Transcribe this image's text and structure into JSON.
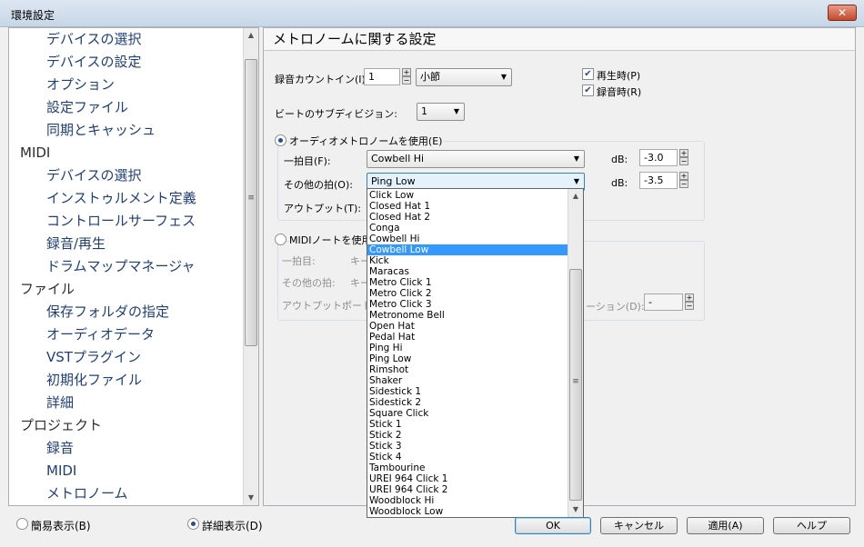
{
  "window": {
    "title": "環境設定",
    "close_glyph": "✕"
  },
  "tree": {
    "items": [
      {
        "label": "デバイスの選択",
        "level": 1
      },
      {
        "label": "デバイスの設定",
        "level": 1
      },
      {
        "label": "オプション",
        "level": 1
      },
      {
        "label": "設定ファイル",
        "level": 1
      },
      {
        "label": "同期とキャッシュ",
        "level": 1
      },
      {
        "label": "MIDI",
        "level": 0
      },
      {
        "label": "デバイスの選択",
        "level": 1
      },
      {
        "label": "インストゥルメント定義",
        "level": 1
      },
      {
        "label": "コントロールサーフェス",
        "level": 1
      },
      {
        "label": "録音/再生",
        "level": 1
      },
      {
        "label": "ドラムマップマネージャ",
        "level": 1
      },
      {
        "label": "ファイル",
        "level": 0
      },
      {
        "label": "保存フォルダの指定",
        "level": 1
      },
      {
        "label": "オーディオデータ",
        "level": 1
      },
      {
        "label": "VSTプラグイン",
        "level": 1
      },
      {
        "label": "初期化ファイル",
        "level": 1
      },
      {
        "label": "詳細",
        "level": 1
      },
      {
        "label": "プロジェクト",
        "level": 0
      },
      {
        "label": "録音",
        "level": 1
      },
      {
        "label": "MIDI",
        "level": 1
      },
      {
        "label": "メトロノーム",
        "level": 1
      }
    ]
  },
  "panel": {
    "header": "メトロノームに関する設定",
    "count_in_label": "録音カウントイン(I):",
    "count_in_value": "1",
    "count_in_unit": "小節",
    "play_label": "再生時(P)",
    "rec_label": "録音時(R)",
    "subdiv_label": "ビートのサブディビジョン:",
    "subdiv_value": "1",
    "audio_radio_label": "オーディオメトロノームを使用(E)",
    "first_beat_label": "一拍目(F):",
    "first_beat_value": "Cowbell Hi",
    "other_beat_label": "その他の拍(O):",
    "other_beat_value": "Ping Low",
    "db_label": "dB:",
    "first_db": "-3.0",
    "other_db": "-3.5",
    "output_label": "アウトプット(T):",
    "midi_radio_label": "MIDIノートを使用(",
    "midi_first_label": "一拍目:",
    "midi_first_key": "キー",
    "midi_other_label": "その他の拍:",
    "midi_other_key": "キー",
    "midi_output_label": "アウトプット:",
    "midi_output_value": "ポート",
    "midi_velocity_label": "ーション(D):",
    "midi_velocity_value": "-"
  },
  "dropdown": {
    "selected": "Cowbell Low",
    "options": [
      "Click Low",
      "Closed Hat 1",
      "Closed Hat 2",
      "Conga",
      "Cowbell Hi",
      "Cowbell Low",
      "Kick",
      "Maracas",
      "Metro Click 1",
      "Metro Click 2",
      "Metro Click 3",
      "Metronome Bell",
      "Open Hat",
      "Pedal Hat",
      "Ping Hi",
      "Ping Low",
      "Rimshot",
      "Shaker",
      "Sidestick 1",
      "Sidestick 2",
      "Square Click",
      "Stick 1",
      "Stick 2",
      "Stick 3",
      "Stick 4",
      "Tambourine",
      "UREI 964 Click 1",
      "UREI 964 Click 2",
      "Woodblock Hi",
      "Woodblock Low"
    ]
  },
  "footer": {
    "simple_label": "簡易表示(B)",
    "detail_label": "詳細表示(D)",
    "ok": "OK",
    "cancel": "キャンセル",
    "apply": "適用(A)",
    "help": "ヘルプ"
  }
}
